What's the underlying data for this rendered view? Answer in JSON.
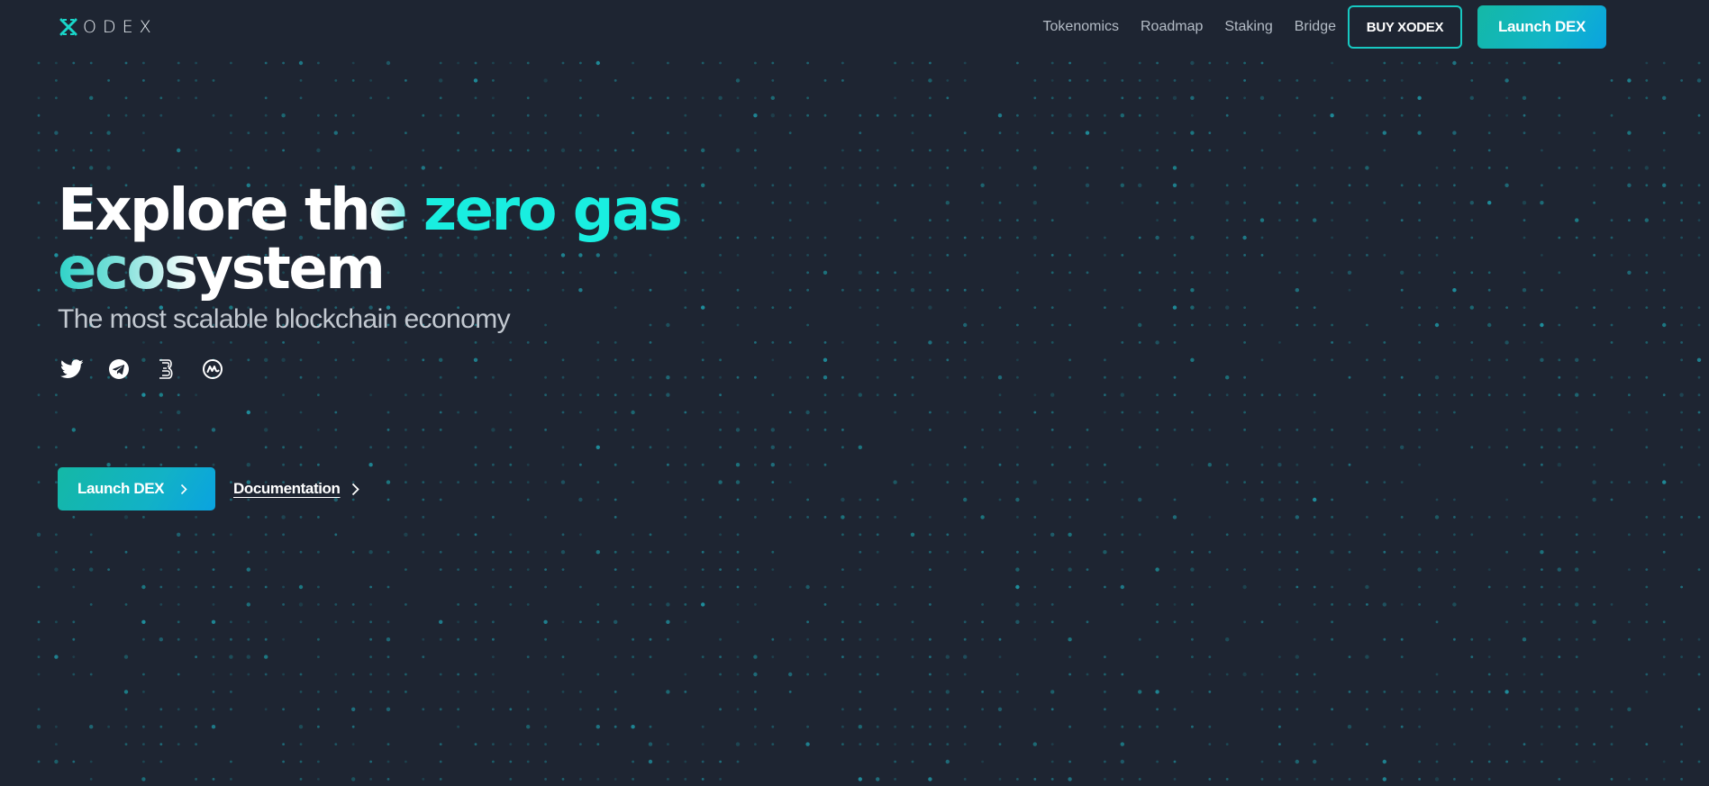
{
  "colors": {
    "background": "#1e2532",
    "accent": "#19eee0",
    "button_gradient_start": "#14b8a6",
    "button_gradient_end": "#0aa3e0",
    "dot_color": "#1fb5c4"
  },
  "header": {
    "logo_text": "ODEX",
    "nav": [
      {
        "label": "Tokenomics"
      },
      {
        "label": "Roadmap"
      },
      {
        "label": "Staking"
      },
      {
        "label": "Bridge"
      }
    ],
    "buy_label": "BUY XODEX",
    "launch_label": "Launch DEX"
  },
  "hero": {
    "title_part1": "Explore th",
    "title_part2": "e ",
    "title_accent": "zero gas",
    "title_part3": "ecos",
    "title_part4": "ystem",
    "subtitle": "The most scalable blockchain economy",
    "socials": [
      {
        "icon": "twitter-icon"
      },
      {
        "icon": "telegram-icon"
      },
      {
        "icon": "b-logo-icon"
      },
      {
        "icon": "coinmarketcap-icon"
      }
    ],
    "cta_launch": "Launch DEX",
    "cta_docs": "Documentation"
  }
}
